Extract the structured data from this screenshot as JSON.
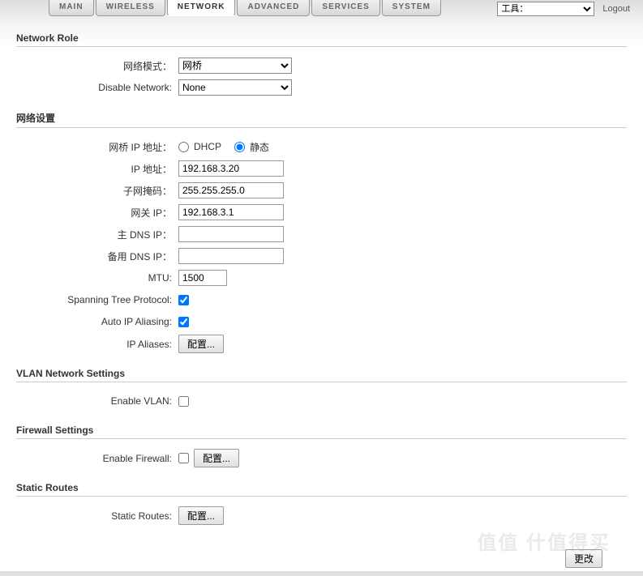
{
  "tabs": {
    "main": "MAIN",
    "wireless": "WIRELESS",
    "network": "NETWORK",
    "advanced": "ADVANCED",
    "services": "SERVICES",
    "system": "SYSTEM"
  },
  "topright": {
    "tools_label": "工具：",
    "logout": "Logout"
  },
  "sections": {
    "network_role": "Network Role",
    "network_settings": "网络设置",
    "vlan": "VLAN Network Settings",
    "firewall": "Firewall Settings",
    "static_routes": "Static Routes"
  },
  "labels": {
    "network_mode": "网络模式：",
    "disable_network": "Disable Network:",
    "bridge_ip": "网桥 IP 地址：",
    "ip_addr": "IP 地址：",
    "netmask": "子网掩码：",
    "gateway": "网关 IP：",
    "primary_dns": "主 DNS IP：",
    "secondary_dns": "备用 DNS IP：",
    "mtu": "MTU:",
    "stp": "Spanning Tree Protocol:",
    "auto_ip": "Auto IP Aliasing:",
    "ip_aliases": "IP Aliases:",
    "enable_vlan": "Enable VLAN:",
    "enable_firewall": "Enable Firewall:",
    "static_routes_label": "Static Routes:"
  },
  "values": {
    "network_mode": "网桥",
    "disable_network": "None",
    "dhcp_option": "DHCP",
    "static_option": "静态",
    "ip_addr": "192.168.3.20",
    "netmask": "255.255.255.0",
    "gateway": "192.168.3.1",
    "primary_dns": "",
    "secondary_dns": "",
    "mtu": "1500",
    "stp_checked": true,
    "auto_ip_checked": true,
    "enable_vlan_checked": false,
    "enable_firewall_checked": false,
    "configure_btn": "配置..."
  },
  "footer": {
    "apply": "更改"
  },
  "watermark": "值值 什值得买"
}
